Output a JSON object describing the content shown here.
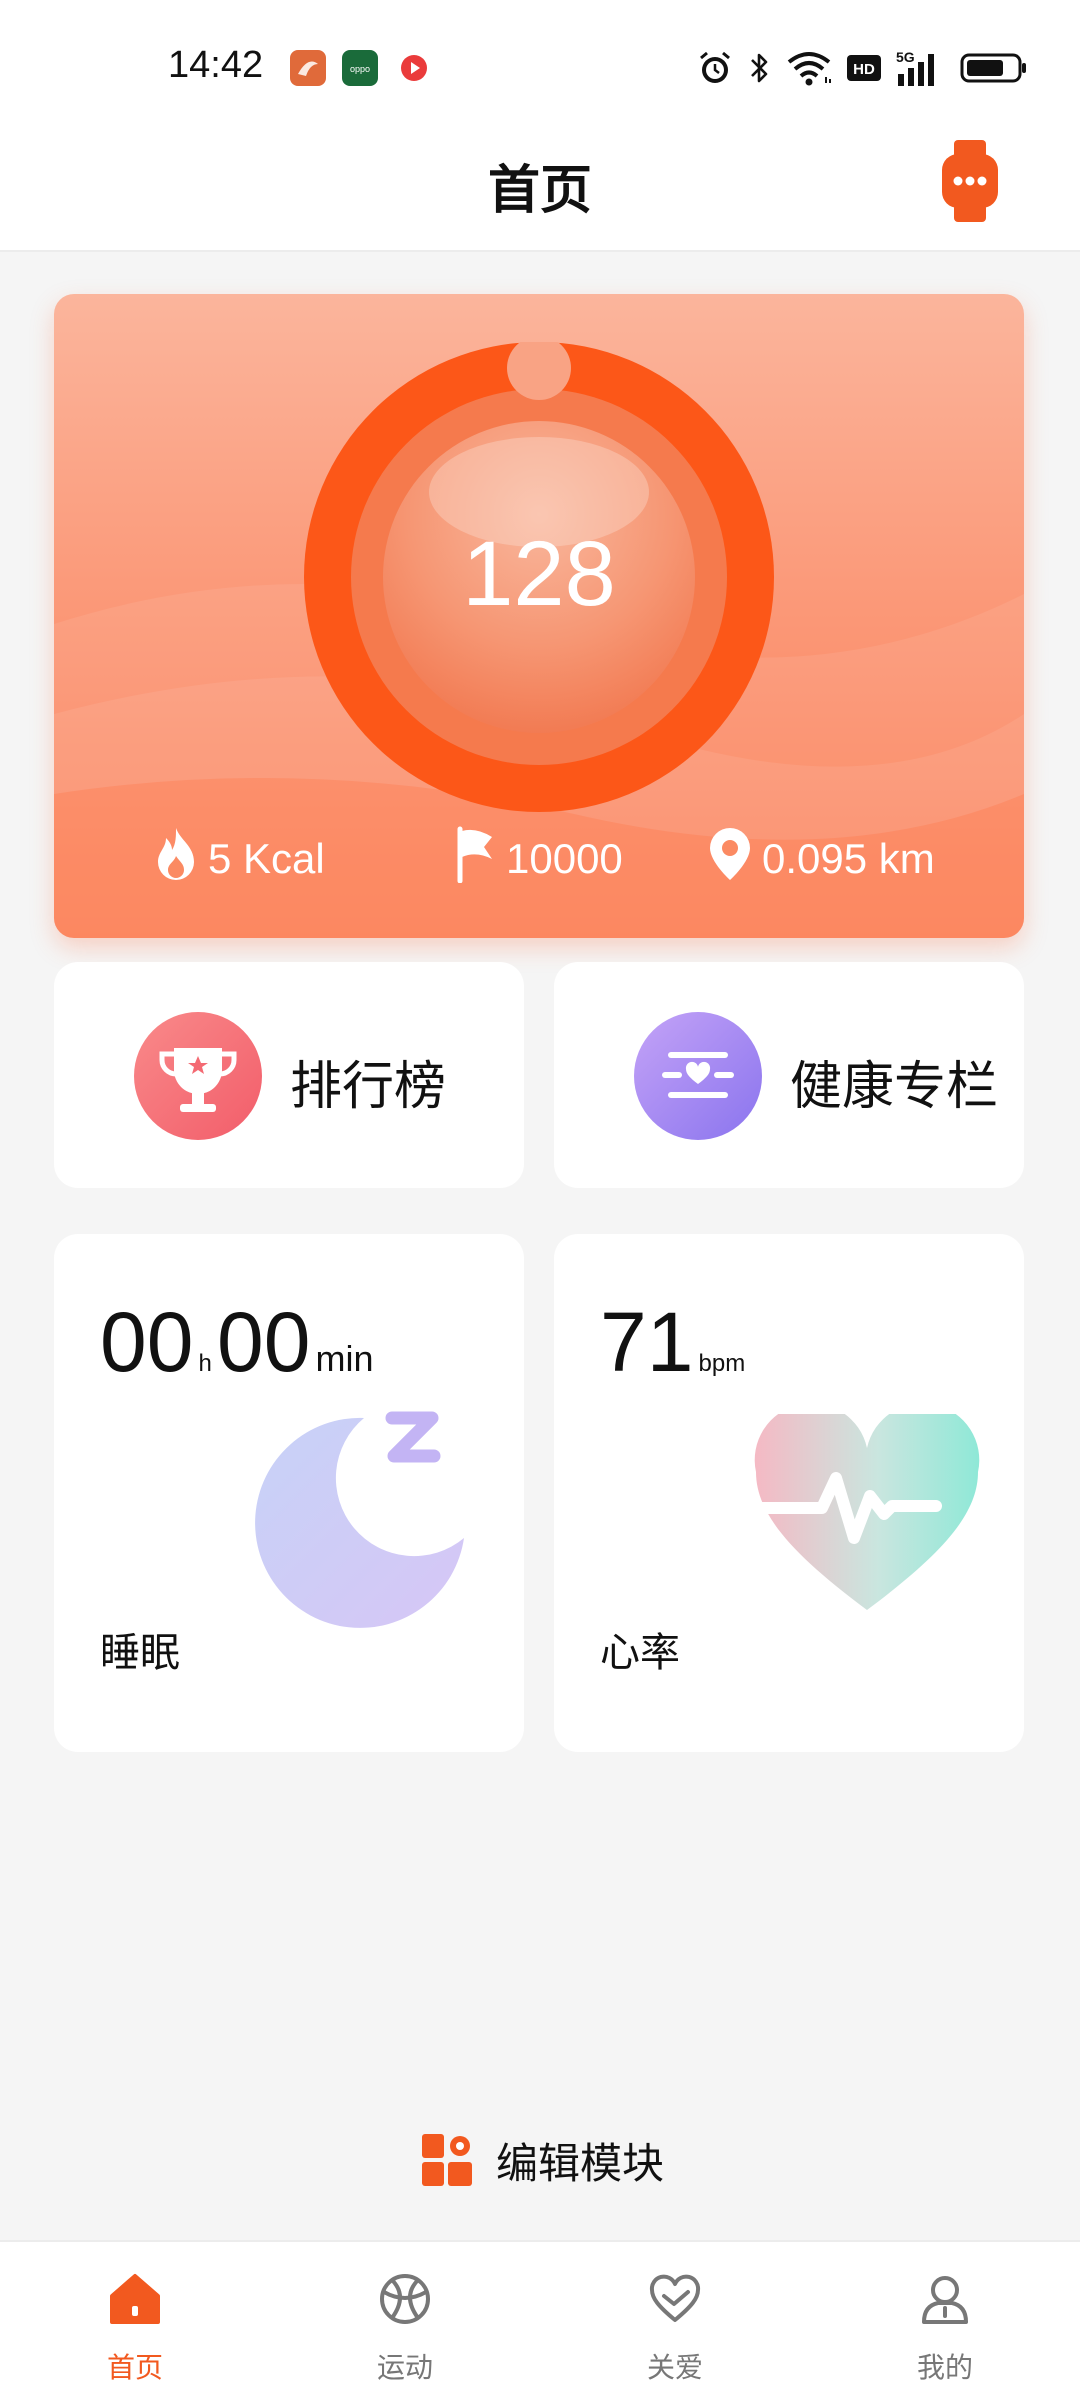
{
  "status_bar": {
    "time": "14:42",
    "app_icons": [
      "orange-app-icon",
      "oppo-app-icon",
      "video-app-icon"
    ],
    "system_icons": [
      "alarm-icon",
      "bluetooth-icon",
      "wifi-icon",
      "hd-icon",
      "signal-5g-icon",
      "battery-icon"
    ]
  },
  "header": {
    "title": "首页",
    "watch_icon": "watch-icon"
  },
  "step_card": {
    "steps": "128",
    "stats": [
      {
        "icon": "flame-icon",
        "value": "5 Kcal"
      },
      {
        "icon": "flag-icon",
        "value": "10000"
      },
      {
        "icon": "location-pin-icon",
        "value": "0.095 km"
      }
    ],
    "accent_color": "#fc5718"
  },
  "quick_cards": [
    {
      "label": "排行榜",
      "icon": "trophy-icon"
    },
    {
      "label": "健康专栏",
      "icon": "health-column-icon"
    }
  ],
  "sleep": {
    "hours": "00",
    "hours_unit": "h",
    "minutes": "00",
    "minutes_unit": "min",
    "label": "睡眠",
    "icon": "moon-sleep-icon"
  },
  "heart_rate": {
    "value": "71",
    "unit": "bpm",
    "label": "心率",
    "icon": "heart-pulse-icon"
  },
  "edit_module": {
    "label": "编辑模块",
    "icon": "module-grid-icon"
  },
  "tabs": [
    {
      "label": "首页",
      "icon": "home-icon",
      "active": true
    },
    {
      "label": "运动",
      "icon": "sport-ball-icon",
      "active": false
    },
    {
      "label": "关爱",
      "icon": "care-heart-icon",
      "active": false
    },
    {
      "label": "我的",
      "icon": "profile-icon",
      "active": false
    }
  ],
  "colors": {
    "brand_orange": "#f2591f",
    "background": "#f5f5f5"
  }
}
